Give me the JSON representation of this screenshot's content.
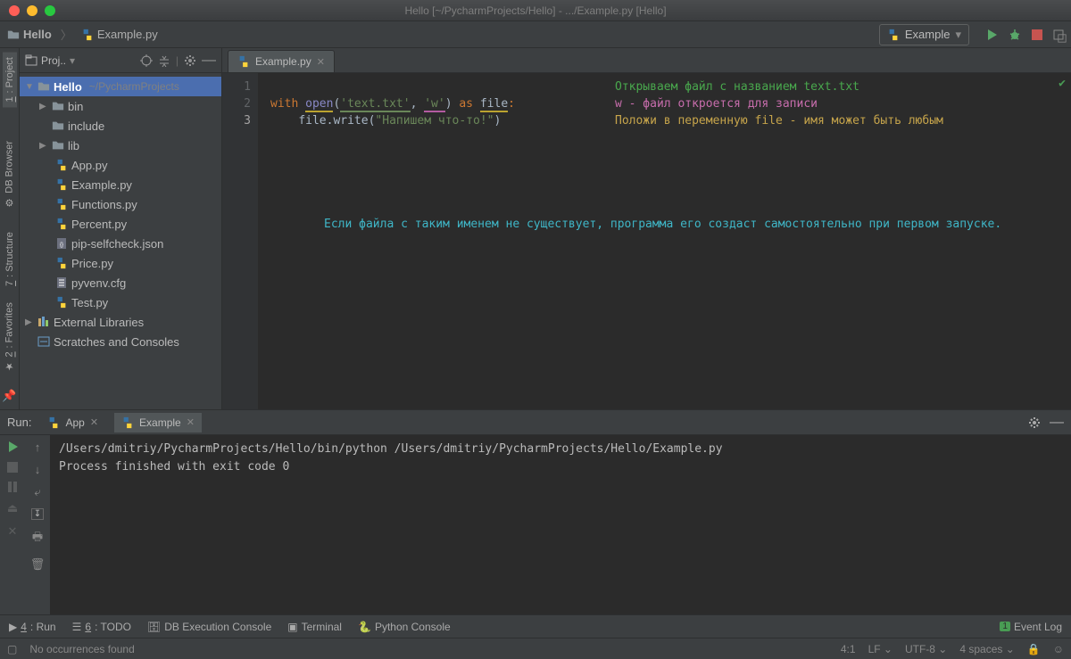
{
  "window": {
    "title": "Hello [~/PycharmProjects/Hello] - .../Example.py [Hello]"
  },
  "breadcrumb": {
    "project": "Hello",
    "file": "Example.py"
  },
  "run_config": "Example",
  "left_tabs": {
    "project_num": "1",
    "project_label": ": Project",
    "db": "DB Browser",
    "structure_num": "7",
    "structure_label": ": Structure",
    "favorites_num": "2",
    "favorites_label": ": Favorites"
  },
  "project_panel": {
    "title": "Proj..",
    "root": "Hello",
    "root_path": "~/PycharmProjects",
    "folders": [
      "bin",
      "include",
      "lib"
    ],
    "files": [
      "App.py",
      "Example.py",
      "Functions.py",
      "Percent.py",
      "pip-selfcheck.json",
      "Price.py",
      "pyvenv.cfg",
      "Test.py"
    ],
    "ext_lib": "External Libraries",
    "scratches": "Scratches and Consoles"
  },
  "editor_tab": {
    "name": "Example.py"
  },
  "editor": {
    "lines": [
      "1",
      "2",
      "3"
    ],
    "l1_with": "with",
    "l1_open": "open",
    "l1_lp": "(",
    "l1_str1": "'text.txt'",
    "l1_comma": ", ",
    "l1_str2": "'w'",
    "l1_rp": ")",
    "l1_as": " as ",
    "l1_var": "file",
    "l1_colon": ":",
    "l2_indent": "    ",
    "l2_var": "file",
    "l2_dot": ".write(",
    "l2_str": "\"Напишем что-то!\"",
    "l2_rp": ")"
  },
  "annotations": {
    "green": "Открываем файл с названием text.txt",
    "pink": "w - файл откроется для записи",
    "yellow": "Положи в переменную file - имя может быть любым",
    "cyan": "Если файла с таким именем не существует, программа его создаст самостоятельно при первом запуске."
  },
  "run": {
    "label": "Run:",
    "tabs": [
      "App",
      "Example"
    ],
    "line1": "/Users/dmitriy/PycharmProjects/Hello/bin/python /Users/dmitriy/PycharmProjects/Hello/Example.py",
    "line2": "",
    "line3": "Process finished with exit code 0"
  },
  "bottom_tools": {
    "run_num": "4",
    "run": ": Run",
    "todo_num": "6",
    "todo": ": TODO",
    "db": "DB Execution Console",
    "terminal": "Terminal",
    "pyconsole": "Python Console",
    "eventlog": "Event Log"
  },
  "status": {
    "msg": "No occurrences found",
    "pos": "4:1",
    "lf": "LF",
    "enc": "UTF-8",
    "indent": "4 spaces"
  }
}
